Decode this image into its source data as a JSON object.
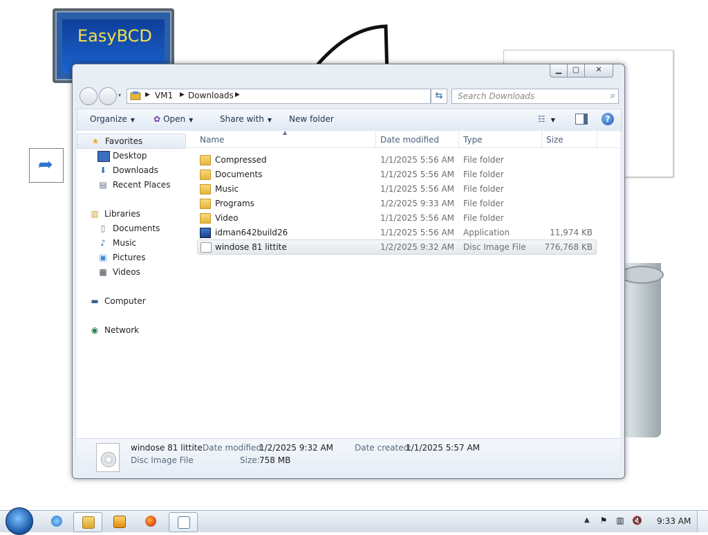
{
  "desktop": {
    "monitor_label": "EasyBCD"
  },
  "window": {
    "address": {
      "crumbs": [
        "VM1",
        "Downloads"
      ]
    },
    "search": {
      "placeholder": "Search Downloads"
    },
    "toolbar": {
      "organize_label": "Organize",
      "open_label": "Open",
      "share_label": "Share with",
      "new_folder_label": "New folder"
    },
    "nav": {
      "favorites": "Favorites",
      "desktop": "Desktop",
      "downloads": "Downloads",
      "recent_places": "Recent Places",
      "libraries": "Libraries",
      "documents": "Documents",
      "music": "Music",
      "pictures": "Pictures",
      "videos": "Videos",
      "computer": "Computer",
      "network": "Network"
    },
    "columns": {
      "name": "Name",
      "date_modified": "Date modified",
      "type": "Type",
      "size": "Size"
    },
    "files": [
      {
        "name": "Compressed",
        "date": "1/1/2025 5:56 AM",
        "type": "File folder",
        "size": "",
        "icon": "folder-icon"
      },
      {
        "name": "Documents",
        "date": "1/1/2025 5:56 AM",
        "type": "File folder",
        "size": "",
        "icon": "folder-icon"
      },
      {
        "name": "Music",
        "date": "1/1/2025 5:56 AM",
        "type": "File folder",
        "size": "",
        "icon": "folder-icon"
      },
      {
        "name": "Programs",
        "date": "1/2/2025 9:33 AM",
        "type": "File folder",
        "size": "",
        "icon": "folder-icon"
      },
      {
        "name": "Video",
        "date": "1/1/2025 5:56 AM",
        "type": "File folder",
        "size": "",
        "icon": "folder-icon"
      },
      {
        "name": "idman642build26",
        "date": "1/1/2025 5:56 AM",
        "type": "Application",
        "size": "11,974 KB",
        "icon": "application-icon"
      },
      {
        "name": "windose 81 littite",
        "date": "1/2/2025 9:32 AM",
        "type": "Disc Image File",
        "size": "776,768 KB",
        "icon": "disc-image-icon"
      }
    ],
    "details": {
      "name": "windose 81 littite",
      "type": "Disc Image File",
      "date_modified_label": "Date modified:",
      "date_modified": "1/2/2025 9:32 AM",
      "size_label": "Size:",
      "size": "758 MB",
      "date_created_label": "Date created:",
      "date_created": "1/1/2025 5:57 AM"
    }
  },
  "taskbar": {
    "clock": "9:33 AM"
  }
}
